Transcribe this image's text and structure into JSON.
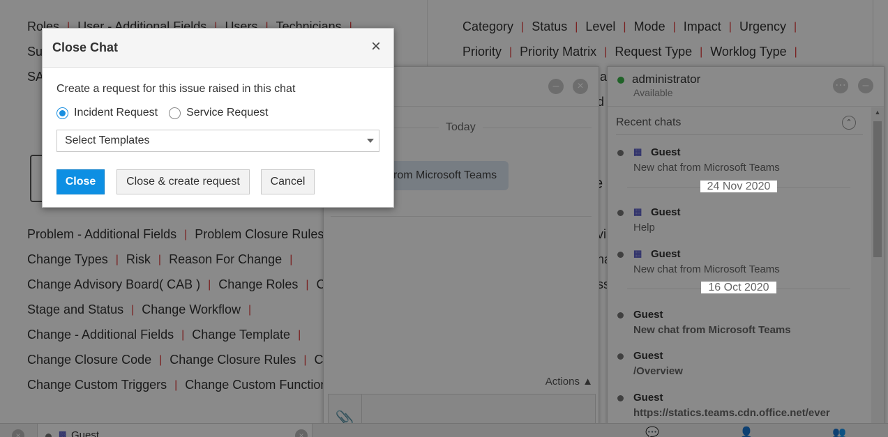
{
  "background": {
    "left_rows": [
      [
        "Roles",
        "User - Additional Fields",
        "Users",
        "Technicians"
      ],
      [
        "Su"
      ],
      [
        "SA"
      ],
      [
        "Problem - Additional Fields",
        "Problem Closure Rules"
      ],
      [
        "Change Types",
        "Risk",
        "Reason For Change"
      ],
      [
        "Change Advisory Board( CAB )",
        "Change Roles",
        "Cha"
      ],
      [
        "Stage and Status",
        "Change Workflow"
      ],
      [
        "Change - Additional Fields",
        "Change Template"
      ],
      [
        "Change Closure Code",
        "Change Closure Rules",
        "Char"
      ],
      [
        "Change Custom Triggers",
        "Change Custom Function"
      ]
    ],
    "right_rows": [
      [
        "Category",
        "Status",
        "Level",
        "Mode",
        "Impact",
        "Urgency"
      ],
      [
        "Priority",
        "Priority Matrix",
        "Request Type",
        "Worklog Type"
      ]
    ],
    "fragments": [
      "la",
      "d",
      "e",
      "vi",
      "na",
      "ss"
    ]
  },
  "chat_window": {
    "today_label": "Today",
    "bubble_text": "rom Microsoft Teams",
    "actions_label": "Actions ▲"
  },
  "chat_panel": {
    "user_name": "administrator",
    "user_status": "Available",
    "recent_title": "Recent chats",
    "items": [
      {
        "name": "Guest",
        "msg": "New chat from Microsoft Teams",
        "teams": true,
        "bold": false
      },
      {
        "date": "24 Nov 2020"
      },
      {
        "name": "Guest",
        "msg": "Help",
        "teams": true,
        "bold": false
      },
      {
        "name": "Guest",
        "msg": "New chat from Microsoft Teams",
        "teams": true,
        "bold": false
      },
      {
        "date": "16 Oct 2020"
      },
      {
        "name": "Guest",
        "msg": "New chat from Microsoft Teams",
        "teams": false,
        "bold": true
      },
      {
        "name": "Guest",
        "msg": "/Overview",
        "teams": false,
        "bold": true
      },
      {
        "name": "Guest",
        "msg": "https://statics.teams.cdn.office.net/ever",
        "teams": false,
        "bold": true
      }
    ]
  },
  "bottom_bar": {
    "guest_label": "Guest"
  },
  "dialog": {
    "title": "Close Chat",
    "prompt": "Create a request for this issue raised in this chat",
    "radio_incident": "Incident Request",
    "radio_service": "Service Request",
    "selected_radio": "incident",
    "template_select": "Select Templates",
    "btn_close": "Close",
    "btn_close_create": "Close & create request",
    "btn_cancel": "Cancel"
  },
  "colors": {
    "accent": "#0d8fe3",
    "separator": "#e03a3a",
    "online": "#3bb54a"
  }
}
